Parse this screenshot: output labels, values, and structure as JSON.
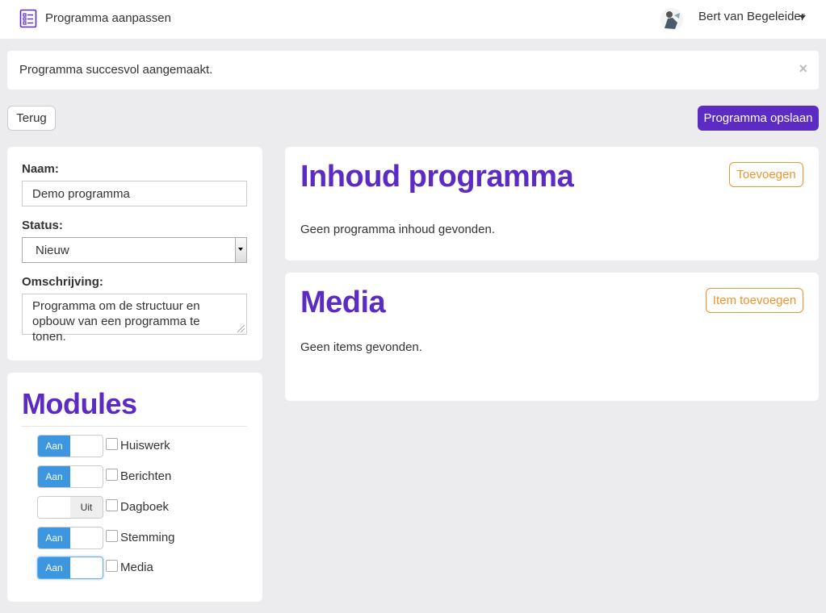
{
  "topbar": {
    "app_icon": "checklist-icon",
    "title": "Programma aanpassen",
    "user_name": "Bert van Begeleider",
    "avatar": "user-avatar"
  },
  "alert": {
    "message": "Programma succesvol aangemaakt.",
    "close_label": "×"
  },
  "actions": {
    "back_label": "Terug",
    "save_label": "Programma opslaan"
  },
  "form": {
    "name_label": "Naam:",
    "name_value": "Demo programma",
    "status_label": "Status:",
    "status_value": "Nieuw",
    "description_label": "Omschrijving:",
    "description_value": "Programma om de structuur en opbouw van een programma te tonen."
  },
  "modules": {
    "heading": "Modules",
    "items": [
      {
        "label": "Huiswerk",
        "state": "Aan",
        "on": true,
        "checked": false
      },
      {
        "label": "Berichten",
        "state": "Aan",
        "on": true,
        "checked": false
      },
      {
        "label": "Dagboek",
        "state": "Uit",
        "on": false,
        "checked": false
      },
      {
        "label": "Stemming",
        "state": "Aan",
        "on": true,
        "checked": false
      },
      {
        "label": "Media",
        "state": "Aan",
        "on": true,
        "checked": false
      }
    ]
  },
  "content": {
    "heading": "Inhoud programma",
    "add_label": "Toevoegen",
    "empty_text": "Geen programma inhoud gevonden."
  },
  "media": {
    "heading": "Media",
    "add_label": "Item toevoegen",
    "empty_text": "Geen items gevonden."
  },
  "colors": {
    "brand_purple": "#5b2bc4",
    "accent_orange": "#f0932b",
    "switch_blue": "#3d96e0",
    "background": "#ececee"
  }
}
